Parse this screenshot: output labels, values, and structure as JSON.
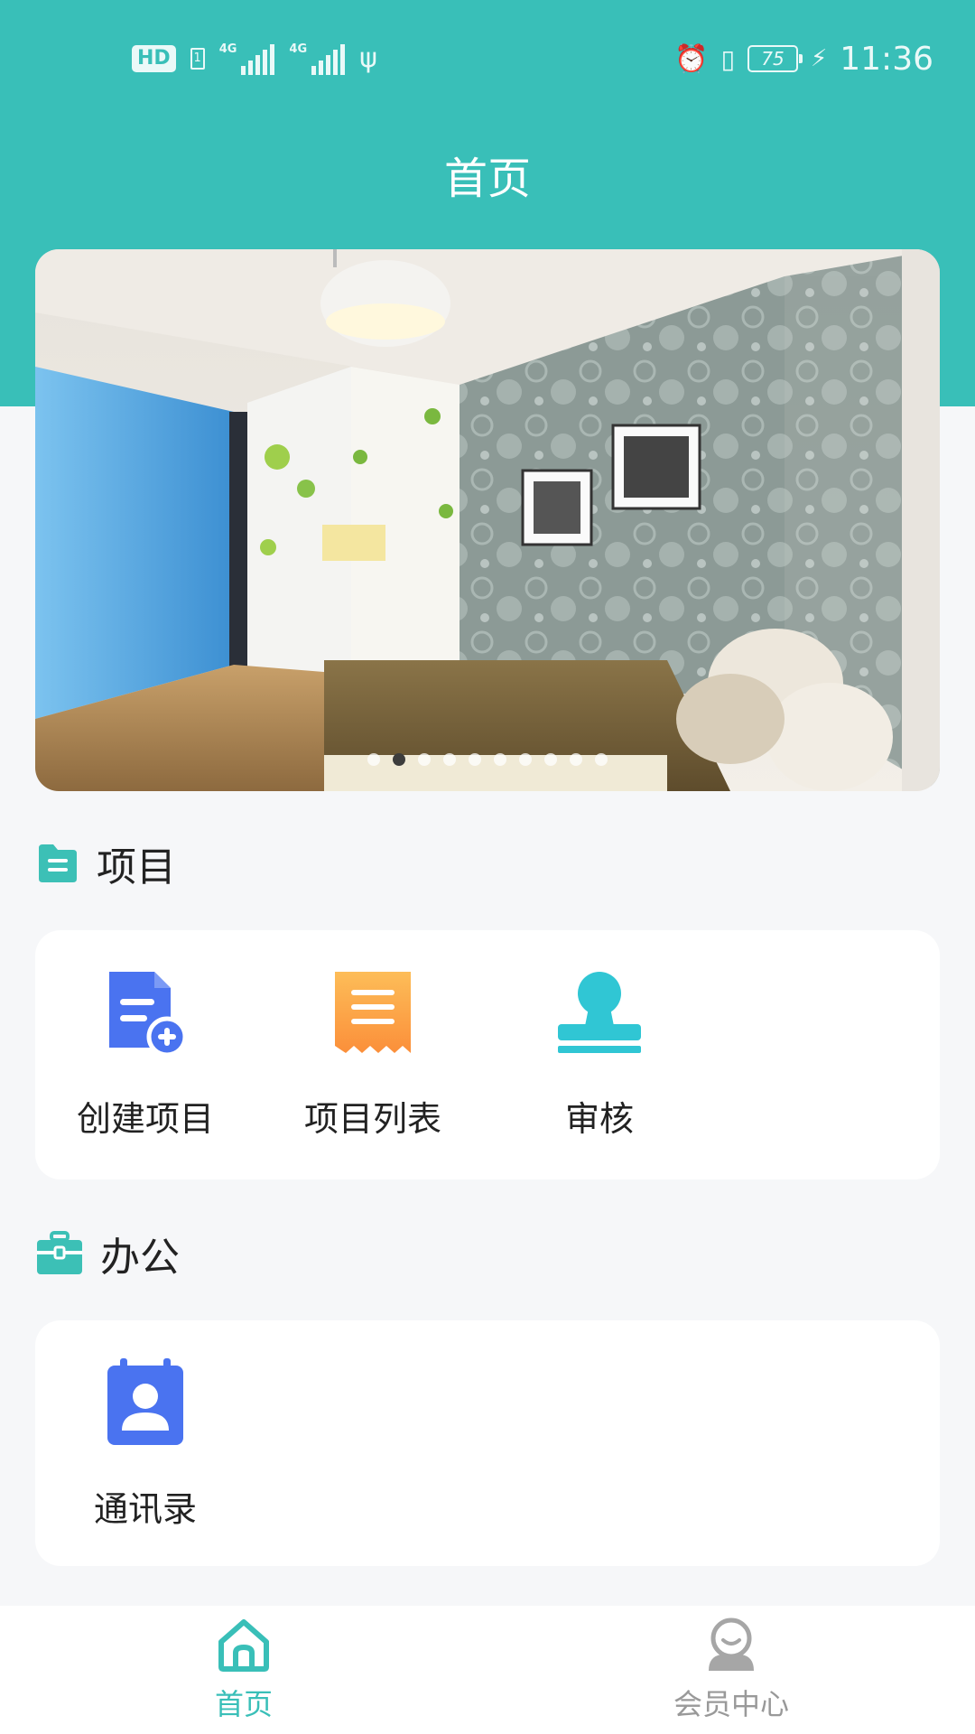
{
  "status_bar": {
    "hd": "HD",
    "sim": "1",
    "net1": "4G",
    "net2": "4G",
    "battery": "75",
    "time": "11:36"
  },
  "header": {
    "title": "首页"
  },
  "banner": {
    "dot_count": 10,
    "active_index": 1,
    "wall_color": "#8a9a96",
    "curtain_color": "#5aa8e0"
  },
  "projects": {
    "title": "项目",
    "items": [
      {
        "label": "创建项目",
        "icon": "create-document-icon"
      },
      {
        "label": "项目列表",
        "icon": "receipt-list-icon"
      },
      {
        "label": "审核",
        "icon": "stamp-icon"
      }
    ]
  },
  "office": {
    "title": "办公",
    "items": [
      {
        "label": "通讯录",
        "icon": "contacts-icon"
      }
    ]
  },
  "tabbar": {
    "items": [
      {
        "label": "首页",
        "icon": "home-icon",
        "active": true
      },
      {
        "label": "会员中心",
        "icon": "member-icon",
        "active": false
      }
    ]
  },
  "colors": {
    "brand": "#39bfb8",
    "inactive": "#999999",
    "blue": "#4a73f0",
    "orange": "#fba542"
  }
}
